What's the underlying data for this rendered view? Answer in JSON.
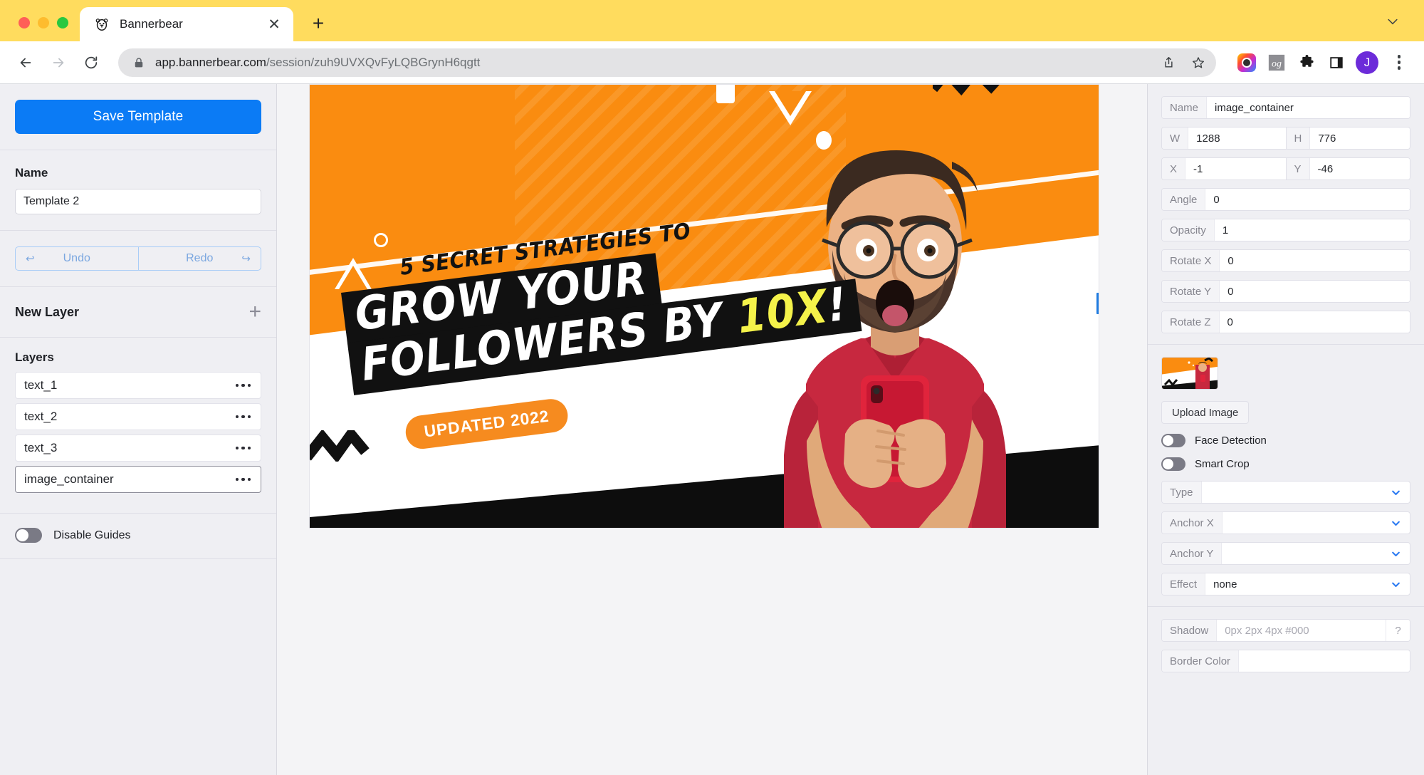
{
  "browser": {
    "tab": {
      "title": "Bannerbear",
      "favicon": "bear-favicon",
      "close_label": "✕"
    },
    "new_tab_label": "+",
    "tabstrip_chevron": "chevron-down-icon",
    "url": {
      "scheme_host": "app.bannerbear.com",
      "path": "/session/zuh9UVXQvFyLQBGrynH6qgtt",
      "lock": "lock-icon"
    },
    "back_label": "←",
    "forward_label": "→",
    "reload_label": "⟳",
    "share_label": "share-icon",
    "bookmark_label": "star-icon",
    "extensions": [
      {
        "name": "camera-extension-icon",
        "label": ""
      },
      {
        "name": "og-extension-icon",
        "label": "og"
      },
      {
        "name": "puzzle-extension-icon",
        "label": ""
      },
      {
        "name": "side-panel-icon",
        "label": ""
      }
    ],
    "avatar_initial": "J",
    "menu_label": "kebab-menu"
  },
  "left_panel": {
    "save_button": "Save Template",
    "name_label": "Name",
    "name_value": "Template 2",
    "undo_label": "Undo",
    "redo_label": "Redo",
    "undo_icon": "↩",
    "redo_icon": "↪",
    "new_layer_label": "New Layer",
    "add_layer_icon": "+",
    "layers_label": "Layers",
    "layers": [
      {
        "name": "text_1",
        "selected": false
      },
      {
        "name": "text_2",
        "selected": false
      },
      {
        "name": "text_3",
        "selected": false
      },
      {
        "name": "image_container",
        "selected": true
      }
    ],
    "disable_guides_label": "Disable Guides",
    "disable_guides_on": false
  },
  "right_panel": {
    "name_label": "Name",
    "name_value": "image_container",
    "w_label": "W",
    "w_value": "1288",
    "h_label": "H",
    "h_value": "776",
    "x_label": "X",
    "x_value": "-1",
    "y_label": "Y",
    "y_value": "-46",
    "angle_label": "Angle",
    "angle_value": "0",
    "opacity_label": "Opacity",
    "opacity_value": "1",
    "rotate_x_label": "Rotate X",
    "rotate_x_value": "0",
    "rotate_y_label": "Rotate Y",
    "rotate_y_value": "0",
    "rotate_z_label": "Rotate Z",
    "rotate_z_value": "0",
    "upload_button": "Upload Image",
    "face_detection_label": "Face Detection",
    "face_detection_on": false,
    "smart_crop_label": "Smart Crop",
    "smart_crop_on": false,
    "type_label": "Type",
    "type_value": "",
    "anchor_x_label": "Anchor X",
    "anchor_x_value": "",
    "anchor_y_label": "Anchor Y",
    "anchor_y_value": "",
    "effect_label": "Effect",
    "effect_value": "none",
    "shadow_label": "Shadow",
    "shadow_placeholder": "0px 2px 4px #000",
    "shadow_help": "?",
    "border_color_label": "Border Color",
    "border_color_value": ""
  },
  "canvas": {
    "banner": {
      "kicker": "5 SECRET STRATEGIES TO",
      "headline_line1": "GROW YOUR",
      "headline_line2_pre": "FOLLOWERS BY ",
      "headline_line2_hl": "10X",
      "headline_line2_post": "!",
      "badge": "UPDATED 2022",
      "bg_color": "#FA8C10",
      "highlight_color": "#F4F24A",
      "badge_color": "#F68B1F",
      "shirt_color": "#C7283F"
    }
  }
}
